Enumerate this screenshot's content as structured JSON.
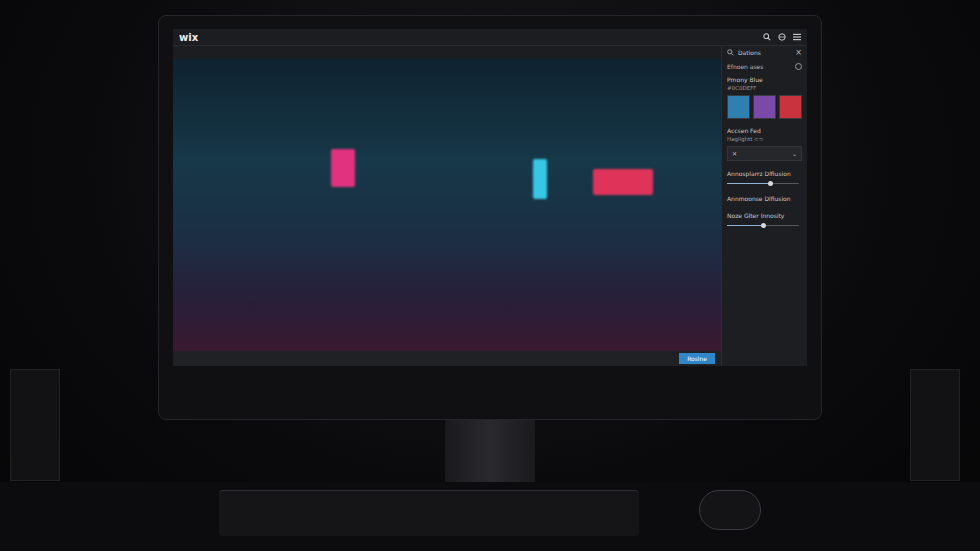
{
  "editor": {
    "logo": "wix"
  },
  "panel": {
    "title": "Dations",
    "close": "×",
    "section": "Efnoen ases",
    "primary": {
      "label": "Pmony Blue",
      "value": "#0C0DEFF"
    },
    "swatches": [
      {
        "color": "#2f7fb0"
      },
      {
        "color": "#7a4aa8"
      },
      {
        "color": "#c8333e"
      }
    ],
    "accent": {
      "label": "Accsen Fed",
      "value": "Haglightt ⊂⊃"
    },
    "dropdown": {
      "value": "✕",
      "arrow": "⌄"
    },
    "controls": [
      {
        "kind": "slider",
        "label": "Annosplarrz Dlfiusion",
        "level": 0.6
      },
      {
        "kind": "label",
        "label": "Annmoonse Dlfiusion"
      },
      {
        "kind": "slider",
        "label": "Noze Glter Innosity",
        "level": 0.5
      }
    ]
  },
  "footer": {
    "button": "Roslne"
  }
}
